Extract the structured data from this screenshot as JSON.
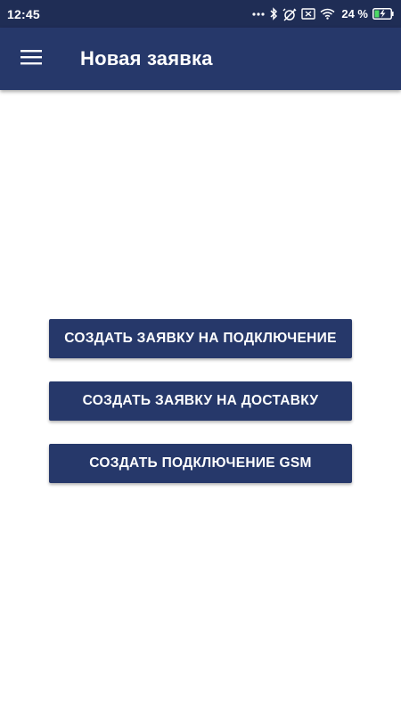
{
  "status_bar": {
    "time": "12:45",
    "battery_text": "24 %",
    "icons": [
      "more-dots-icon",
      "bluetooth-icon",
      "alarm-off-icon",
      "sim-off-icon",
      "wifi-icon",
      "battery-charging-icon"
    ]
  },
  "app_bar": {
    "title": "Новая заявка",
    "menu_icon": "hamburger-menu-icon"
  },
  "actions": {
    "connection_request": "СОЗДАТЬ ЗАЯВКУ НА ПОДКЛЮЧЕНИЕ",
    "delivery_request": "СОЗДАТЬ ЗАЯВКУ НА ДОСТАВКУ",
    "gsm_connection": "СОЗДАТЬ ПОДКЛЮЧЕНИЕ GSM"
  },
  "colors": {
    "status_bar": "#1f2d55",
    "primary": "#26386a",
    "background": "#ffffff",
    "text_on_primary": "#ffffff",
    "battery_charge": "#4cd964"
  }
}
